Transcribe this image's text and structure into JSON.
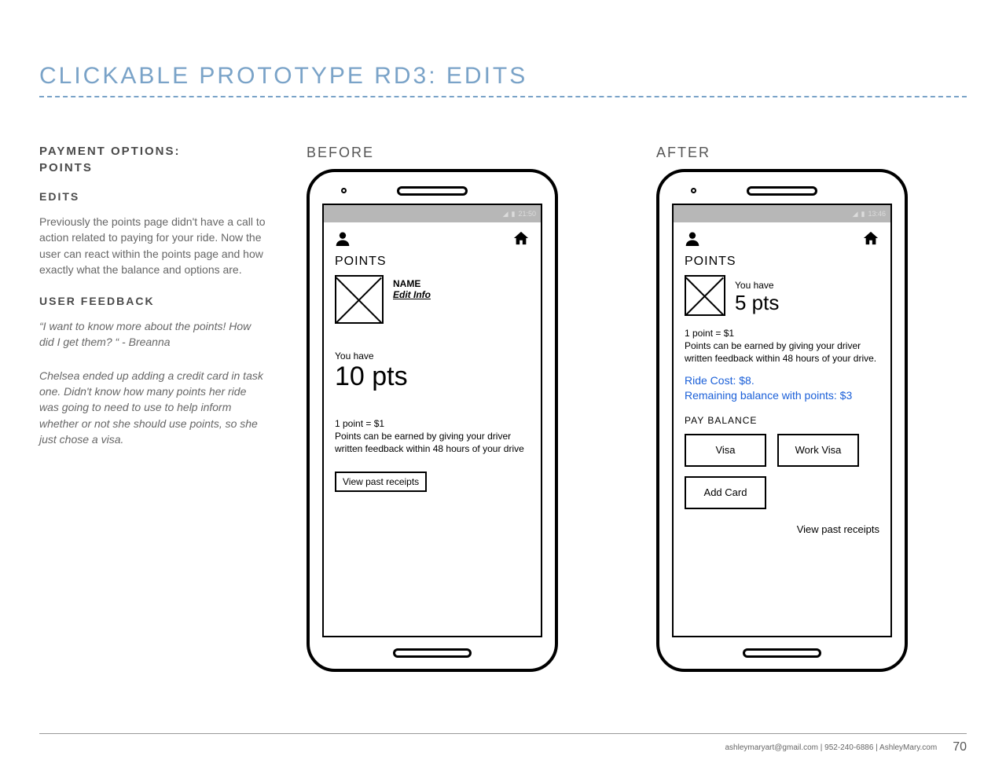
{
  "title": "CLICKABLE PROTOTYPE RD3: EDITS",
  "left": {
    "heading1": "PAYMENT OPTIONS:",
    "heading1b": "POINTS",
    "heading2": "EDITS",
    "para1": "Previously the points page didn't have a call to action related to paying for your ride. Now the user can react within the points page and how exactly what the balance and options are.",
    "heading3": "USER FEEDBACK",
    "quote1": "“I want to know more about the points! How did I get them? “ - Breanna",
    "quote2": "Chelsea ended up adding a credit card in task one. Didn't know how many points her ride was going to need to use to help inform whether or not she should use points, so she just chose a visa."
  },
  "before": {
    "label": "BEFORE",
    "statusTime": "21:50",
    "pointsTitle": "POINTS",
    "name": "NAME",
    "editInfo": "Edit Info",
    "youHave": "You have",
    "pts": "10 pts",
    "rule": "1 point = $1",
    "desc": "Points can be earned by giving your driver written feedback within 48 hours of your drive",
    "receipts": "View past receipts"
  },
  "after": {
    "label": "AFTER",
    "statusTime": "13:46",
    "pointsTitle": "POINTS",
    "youHave": "You have",
    "pts": "5 pts",
    "rule": "1 point = $1",
    "desc": "Points can be earned by giving your driver written feedback within 48 hours of your drive.",
    "rideCost": "Ride Cost: $8.",
    "remaining": "Remaining balance with points: $3",
    "payBalance": "PAY BALANCE",
    "cards": {
      "visa": "Visa",
      "workVisa": "Work Visa",
      "addCard": "Add Card"
    },
    "receipts": "View past receipts"
  },
  "footer": {
    "contact": "ashleymaryart@gmail.com | 952-240-6886 | AshleyMary.com",
    "page": "70"
  }
}
